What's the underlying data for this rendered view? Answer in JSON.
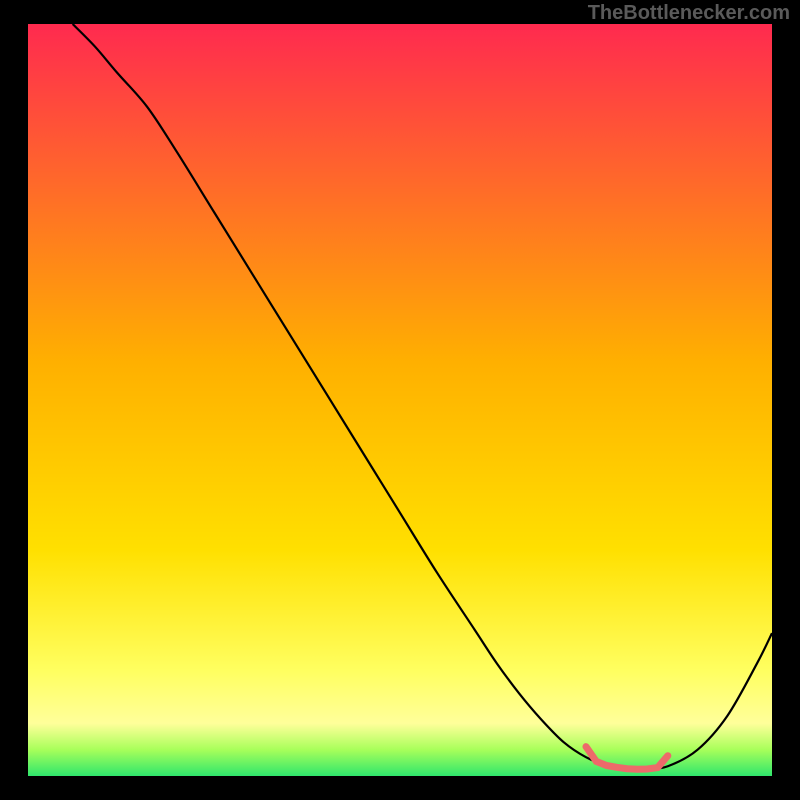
{
  "attribution": "TheBottlenecker.com",
  "colors": {
    "bg": "#000000",
    "top": "#ff2a4f",
    "mid": "#ffd400",
    "yellowBand": "#ffff7a",
    "green": "#2fe66c",
    "curve": "#000000",
    "flatMarker": "#ed6a6a"
  },
  "chart_data": {
    "type": "line",
    "title": "",
    "xlabel": "",
    "ylabel": "",
    "xlim": [
      0,
      100
    ],
    "ylim": [
      0,
      100
    ],
    "series": [
      {
        "name": "bottleneck-curve",
        "x": [
          6,
          9,
          12,
          16,
          20,
          25,
          30,
          35,
          40,
          45,
          50,
          55,
          60,
          63,
          66,
          69,
          72,
          75,
          78,
          81,
          83,
          86,
          90,
          94,
          98,
          100
        ],
        "y": [
          100,
          97,
          93.5,
          89,
          83,
          75,
          67,
          59,
          51,
          43,
          35,
          27,
          19.5,
          15,
          11,
          7.5,
          4.5,
          2.5,
          1.3,
          0.9,
          0.9,
          1.3,
          3.5,
          8,
          15,
          19
        ]
      }
    ],
    "flat_region": {
      "x_start": 75,
      "x_end": 86
    },
    "gradient_stops": [
      {
        "offset": 0,
        "color": "#ff2a4f"
      },
      {
        "offset": 45,
        "color": "#ffb000"
      },
      {
        "offset": 70,
        "color": "#ffe000"
      },
      {
        "offset": 86,
        "color": "#ffff60"
      },
      {
        "offset": 93,
        "color": "#ffff9a"
      },
      {
        "offset": 96.5,
        "color": "#a8ff5a"
      },
      {
        "offset": 100,
        "color": "#2fe66c"
      }
    ]
  }
}
